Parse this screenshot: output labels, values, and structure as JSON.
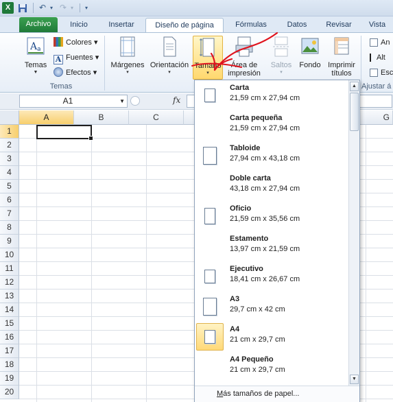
{
  "quick_access": {
    "undo": "↶",
    "redo": "↷",
    "customize": "▾"
  },
  "tabs": [
    {
      "label": "Archivo"
    },
    {
      "label": "Inicio"
    },
    {
      "label": "Insertar"
    },
    {
      "label": "Diseño de página"
    },
    {
      "label": "Fórmulas"
    },
    {
      "label": "Datos"
    },
    {
      "label": "Revisar"
    },
    {
      "label": "Vista"
    }
  ],
  "ribbon": {
    "temas_group": {
      "label": "Temas",
      "temas_button": "Temas",
      "colores": "Colores ▾",
      "fuentes": "Fuentes ▾",
      "efectos": "Efectos ▾"
    },
    "page_setup": {
      "margenes": "Márgenes",
      "orientacion": "Orientación",
      "tamano": "Tamaño",
      "area_impresion_1": "Área de",
      "area_impresion_2": "impresión",
      "saltos": "Saltos",
      "fondo": "Fondo",
      "imprimir_titulos_1": "Imprimir",
      "imprimir_titulos_2": "títulos"
    },
    "ajustar": {
      "label": "Ajustar á",
      "ancho": "An",
      "alto": "Alt",
      "escala": "Esc"
    }
  },
  "formula_bar": {
    "name_box": "A1",
    "fx": "fx",
    "value": ""
  },
  "columns": [
    "A",
    "B",
    "C"
  ],
  "right_column": "G",
  "rows": [
    "1",
    "2",
    "3",
    "4",
    "5",
    "6",
    "7",
    "8",
    "9",
    "10",
    "11",
    "12",
    "13",
    "14",
    "15",
    "16",
    "17",
    "18",
    "19",
    "20"
  ],
  "size_menu": {
    "items": [
      {
        "name": "Carta",
        "dims": "21,59 cm x 27,94 cm",
        "orient": "portrait"
      },
      {
        "name": "Carta pequeña",
        "dims": "21,59 cm x 27,94 cm",
        "orient": "none"
      },
      {
        "name": "Tabloide",
        "dims": "27,94 cm x 43,18 cm",
        "orient": "portrait"
      },
      {
        "name": "Doble carta",
        "dims": "43,18 cm x 27,94 cm",
        "orient": "none"
      },
      {
        "name": "Oficio",
        "dims": "21,59 cm x 35,56 cm",
        "orient": "portrait"
      },
      {
        "name": "Estamento",
        "dims": "13,97 cm x 21,59 cm",
        "orient": "none"
      },
      {
        "name": "Ejecutivo",
        "dims": "18,41 cm x 26,67 cm",
        "orient": "portrait"
      },
      {
        "name": "A3",
        "dims": "29,7 cm x 42 cm",
        "orient": "portrait"
      },
      {
        "name": "A4",
        "dims": "21 cm x 29,7 cm",
        "orient": "portrait",
        "selected": true
      },
      {
        "name": "A4 Pequeño",
        "dims": "21 cm x 29,7 cm",
        "orient": "none"
      }
    ],
    "footer_mnemonic": "M",
    "footer_rest": "ás tamaños de papel..."
  },
  "colors": {
    "file_tab": "#1f7a3a",
    "highlight": "#ffd86e",
    "annotation": "#e0141e"
  }
}
